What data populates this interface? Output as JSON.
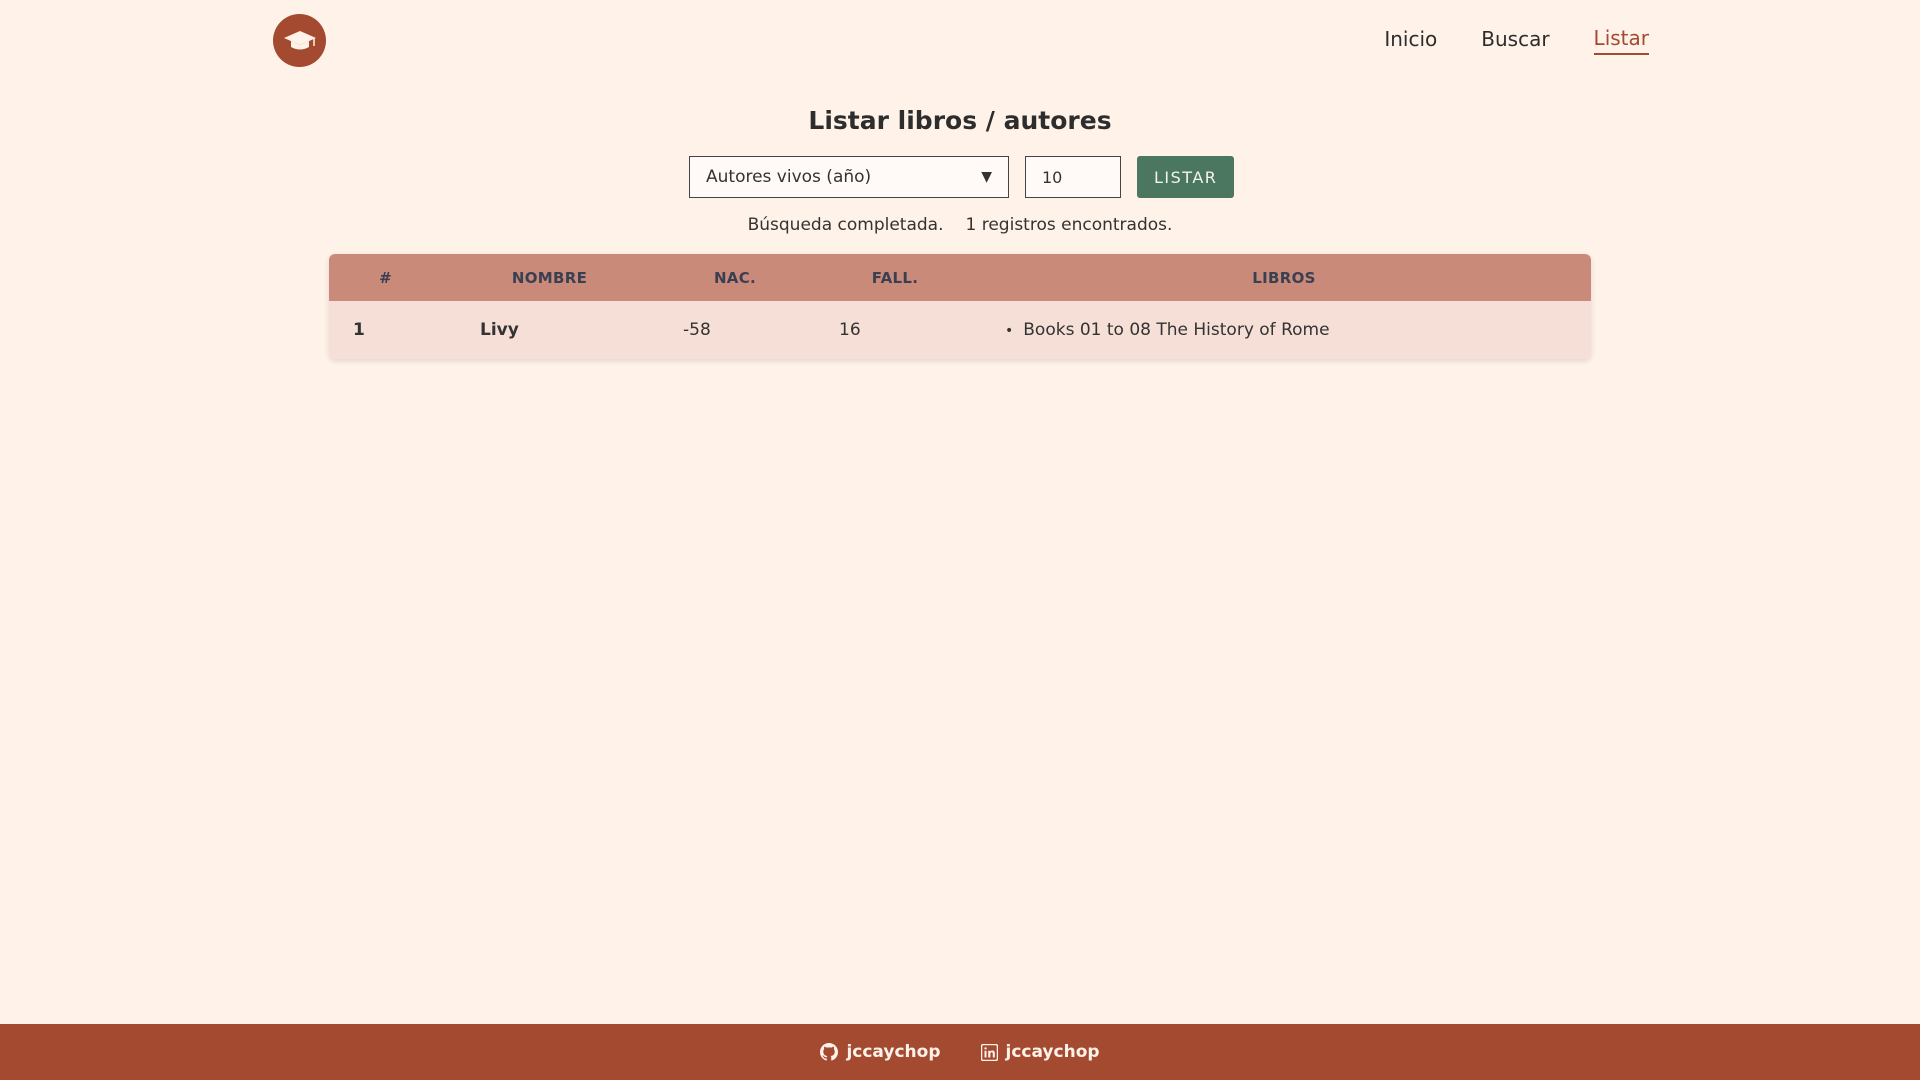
{
  "nav": {
    "items": [
      {
        "label": "Inicio"
      },
      {
        "label": "Buscar"
      },
      {
        "label": "Listar"
      }
    ]
  },
  "page": {
    "title": "Listar libros / autores"
  },
  "controls": {
    "select_value": "Autores vivos (año)",
    "year_value": "10",
    "list_button": "LISTAR"
  },
  "status": {
    "message": "Búsqueda completada.",
    "count": "1 registros encontrados."
  },
  "table": {
    "headers": [
      "#",
      "NOMBRE",
      "NAC.",
      "FALL.",
      "LIBROS"
    ],
    "rows": [
      {
        "index": "1",
        "name": "Livy",
        "birth": "-58",
        "death": "16",
        "books": [
          "Books 01 to 08 The History of Rome"
        ]
      }
    ]
  },
  "footer": {
    "github": "jccaychop",
    "linkedin": "jccaychop"
  },
  "colors": {
    "brand": "#a34a31",
    "button": "#4b7760",
    "table_header": "#c98a79",
    "table_row": "#f5dfd6",
    "background": "#fff2e8"
  }
}
